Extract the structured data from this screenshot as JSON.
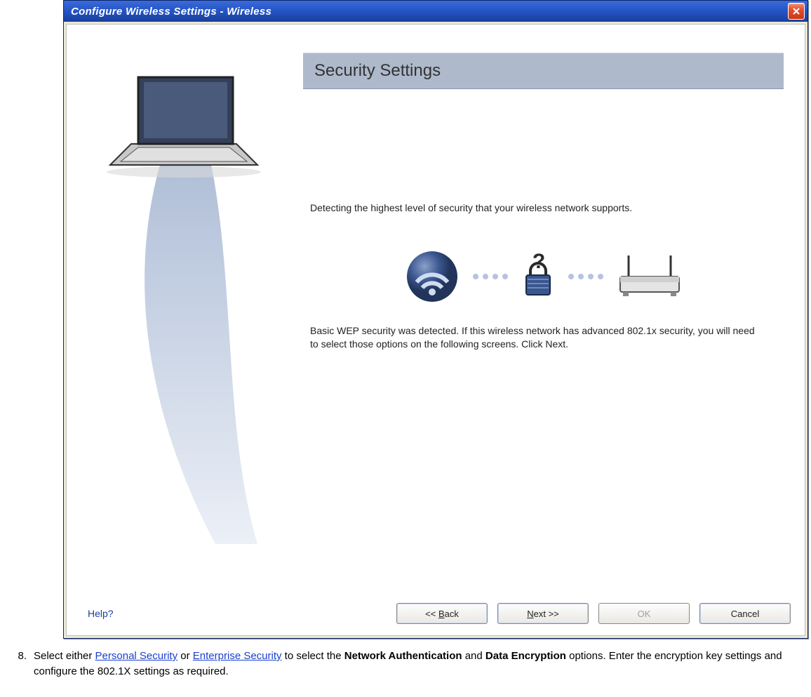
{
  "window": {
    "title": "Configure Wireless Settings  -  Wireless"
  },
  "banner": {
    "heading": "Security Settings"
  },
  "content": {
    "detecting_text": "Detecting the highest level of security that your wireless network supports.",
    "result_text": "Basic WEP security was detected. If this wireless network has advanced 802.1x security, you will need to select those options on the following screens. Click Next."
  },
  "footer": {
    "help": "Help?",
    "back": "<< Back",
    "next": "Next >>",
    "ok": "OK",
    "cancel": "Cancel"
  },
  "instruction": {
    "number": "8.",
    "prefix": "Select either ",
    "link1": "Personal Security",
    "mid1": " or ",
    "link2": "Enterprise Security",
    "mid2": " to select the ",
    "bold1": "Network Authentication",
    "mid3": " and ",
    "bold2": "Data Encryption",
    "suffix": " options. Enter the encryption key settings and configure the 802.1X settings as required."
  }
}
